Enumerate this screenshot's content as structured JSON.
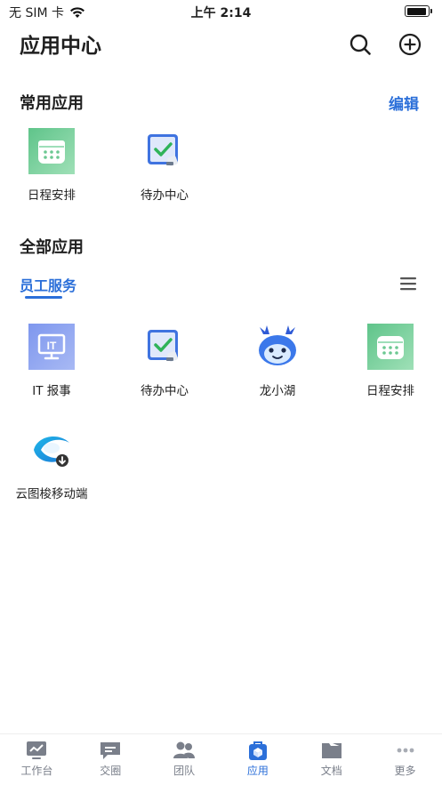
{
  "status_bar": {
    "carrier": "无 SIM 卡",
    "time": "上午 2:14"
  },
  "header": {
    "title": "应用中心"
  },
  "frequent": {
    "title": "常用应用",
    "edit_label": "编辑",
    "apps": [
      {
        "label": "日程安排",
        "icon": "calendar-icon"
      },
      {
        "label": "待办中心",
        "icon": "todo-icon"
      }
    ]
  },
  "all_apps": {
    "title": "全部应用",
    "tab_label": "员工服务",
    "apps": [
      {
        "label": "IT 报事",
        "icon": "it-report-icon",
        "icon_text": "IT"
      },
      {
        "label": "待办中心",
        "icon": "todo-icon"
      },
      {
        "label": "龙小湖",
        "icon": "dragon-mascot-icon"
      },
      {
        "label": "日程安排",
        "icon": "calendar-icon"
      },
      {
        "label": "云图梭移动端",
        "icon": "cloud-app-icon"
      }
    ]
  },
  "tab_bar": {
    "items": [
      {
        "label": "工作台",
        "icon": "workbench-icon",
        "active": false
      },
      {
        "label": "交圈",
        "icon": "chat-icon",
        "active": false
      },
      {
        "label": "团队",
        "icon": "team-icon",
        "active": false
      },
      {
        "label": "应用",
        "icon": "apps-icon",
        "active": true
      },
      {
        "label": "文档",
        "icon": "folder-icon",
        "active": false
      },
      {
        "label": "更多",
        "icon": "more-icon",
        "active": false
      }
    ]
  },
  "colors": {
    "accent": "#2b6fd9",
    "calendar_green": "#6fcf97",
    "tab_inactive": "#7a7f8a"
  }
}
